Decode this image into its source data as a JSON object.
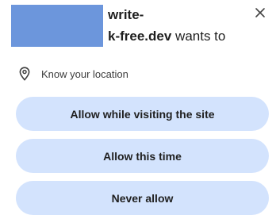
{
  "dialog": {
    "title_line1": "write-",
    "title_site": "k-free.dev",
    "title_suffix": " wants to",
    "close_icon": "close-icon"
  },
  "permission": {
    "icon": "location-pin-icon",
    "label": "Know your location"
  },
  "buttons": {
    "allow_while_visiting": "Allow while visiting the site",
    "allow_this_time": "Allow this time",
    "never_allow": "Never allow"
  },
  "colors": {
    "redaction": "#6c96dc",
    "button_bg": "#d3e3fd"
  }
}
